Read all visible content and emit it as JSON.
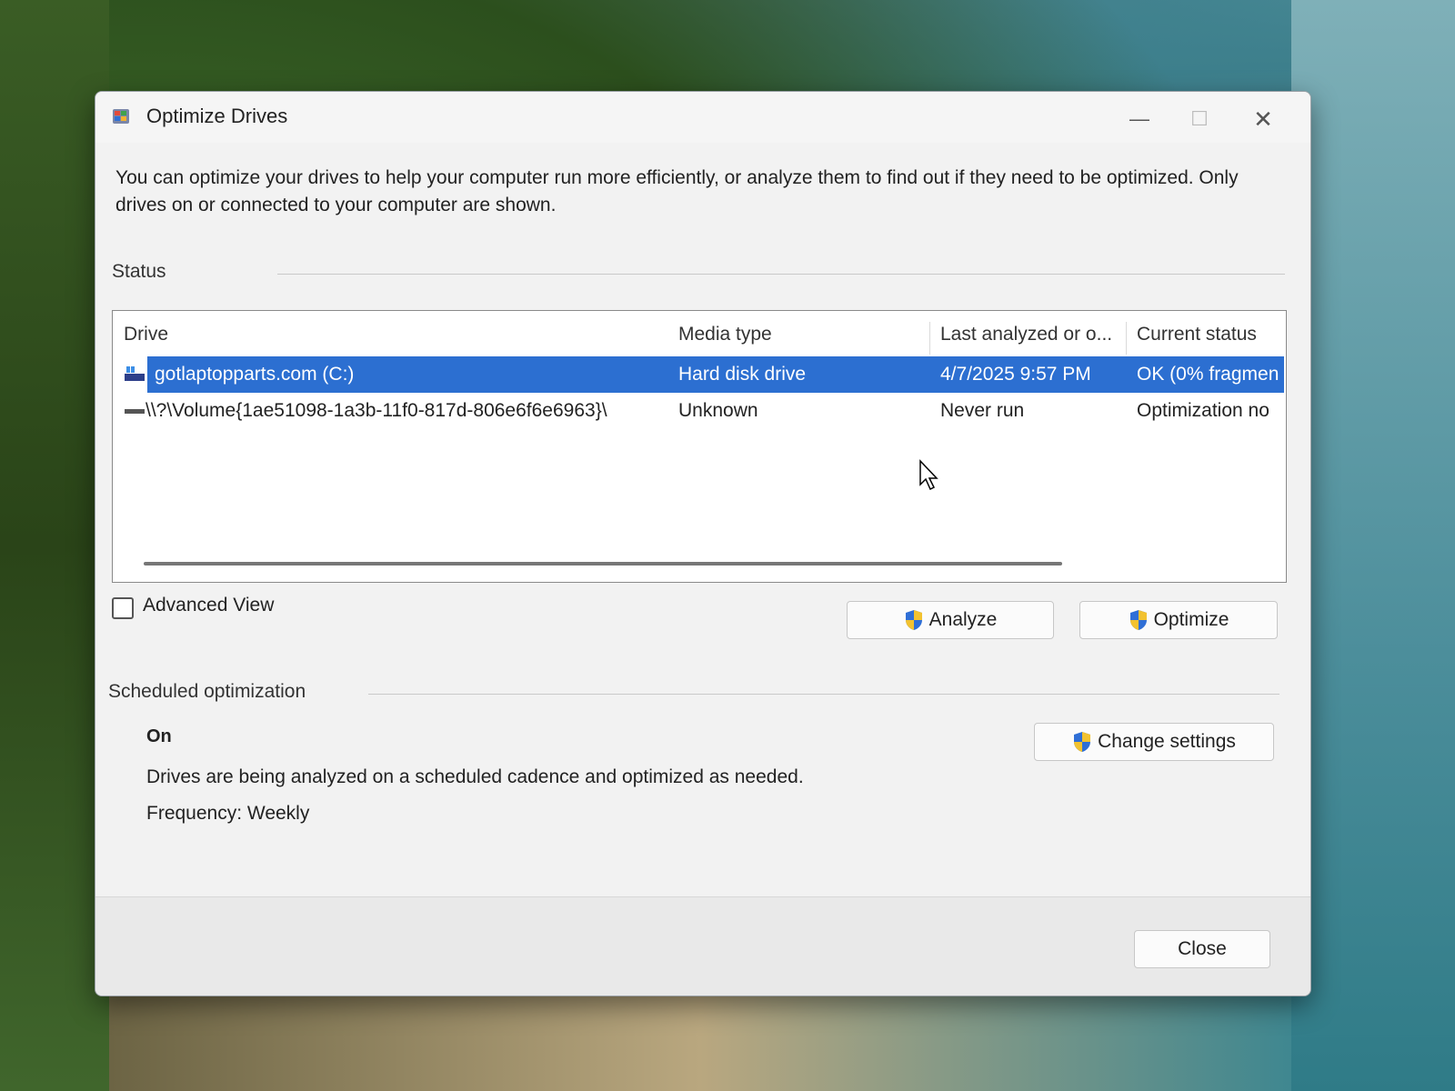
{
  "window": {
    "title": "Optimize Drives",
    "minimize_glyph": "—",
    "maximize_glyph": "☐",
    "close_glyph": "✕"
  },
  "intro_text": "You can optimize your drives to help your computer run more efficiently, or analyze them to find out if they need to be optimized. Only drives on or connected to your computer are shown.",
  "status": {
    "label": "Status",
    "columns": [
      "Drive",
      "Media type",
      "Last analyzed or o...",
      "Current status"
    ],
    "rows": [
      {
        "drive": "gotlaptopparts.com (C:)",
        "media_type": "Hard disk drive",
        "last_analyzed": "4/7/2025 9:57 PM",
        "current_status": "OK (0% fragmen",
        "selected": true,
        "icon": "windows-drive-icon"
      },
      {
        "drive": "\\\\?\\Volume{1ae51098-1a3b-11f0-817d-806e6f6e6963}\\",
        "media_type": "Unknown",
        "last_analyzed": "Never run",
        "current_status": "Optimization no",
        "selected": false,
        "icon": "volume-drive-icon"
      }
    ]
  },
  "advanced_view": {
    "label": "Advanced View",
    "checked": false
  },
  "buttons": {
    "analyze": "Analyze",
    "optimize": "Optimize",
    "change_settings": "Change settings",
    "close": "Close"
  },
  "scheduled": {
    "label": "Scheduled optimization",
    "state": "On",
    "description": "Drives are being analyzed on a scheduled cadence and optimized as needed.",
    "frequency": "Frequency: Weekly"
  },
  "colors": {
    "selection": "#2c6fd1",
    "window_bg": "#f2f2f2"
  }
}
